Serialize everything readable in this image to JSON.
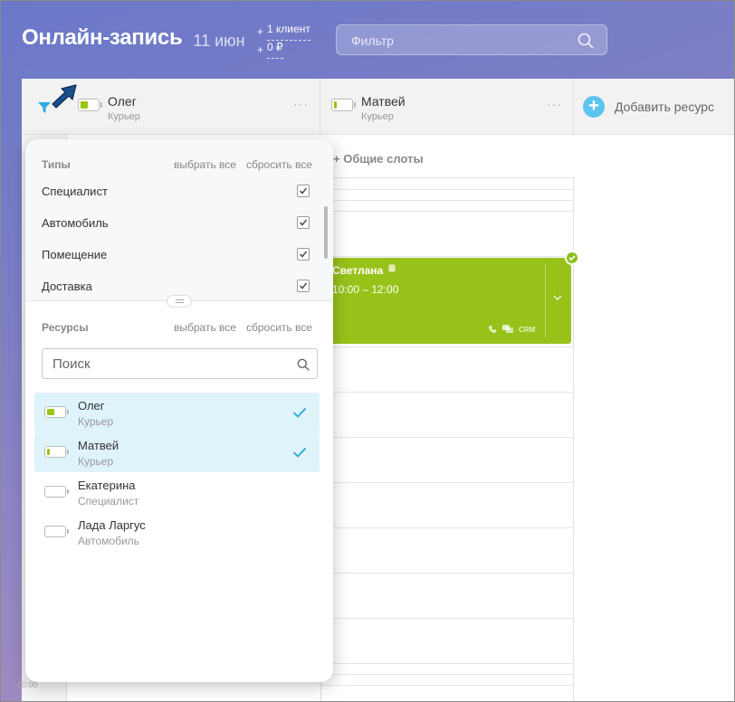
{
  "header": {
    "title": "Онлайн-запись",
    "date": "11 июн",
    "stats": [
      {
        "prefix": "+",
        "value": "1 клиент"
      },
      {
        "prefix": "+",
        "value": "0 ₽"
      }
    ],
    "filter_placeholder": "Фильтр"
  },
  "resources": [
    {
      "name": "Олег",
      "role": "Курьер",
      "more": "···",
      "battery_level": 0.4
    },
    {
      "name": "Матвей",
      "role": "Курьер",
      "more": "···",
      "battery_level": 0.15
    }
  ],
  "add_resource_label": "Добавить ресурс",
  "shared_slots_label": "+ Общие слоты",
  "event": {
    "name": "Светлана",
    "time": "10:00 – 12:00",
    "crm_label": "CRM",
    "color": "#98c21a"
  },
  "time_label": "00:00",
  "filter_popup": {
    "types_title": "Типы",
    "select_all": "выбрать все",
    "reset_all": "сбросить все",
    "types": [
      {
        "label": "Специалист",
        "checked": true
      },
      {
        "label": "Автомобиль",
        "checked": true
      },
      {
        "label": "Помещение",
        "checked": true
      },
      {
        "label": "Доставка",
        "checked": true
      }
    ],
    "resources_title": "Ресурсы",
    "search_placeholder": "Поиск",
    "resources": [
      {
        "name": "Олег",
        "role": "Курьер",
        "selected": true,
        "battery_level": 0.4
      },
      {
        "name": "Матвей",
        "role": "Курьер",
        "selected": true,
        "battery_level": 0.15
      },
      {
        "name": "Екатерина",
        "role": "Специалист",
        "selected": false,
        "battery_level": 0
      },
      {
        "name": "Лада Ларгус",
        "role": "Автомобиль",
        "selected": false,
        "battery_level": 0
      }
    ]
  },
  "colors": {
    "accent": "#5dc4f0",
    "battery_green": "#9ac513",
    "selected_row": "#dff3fb",
    "check": "#2aa7d8"
  }
}
